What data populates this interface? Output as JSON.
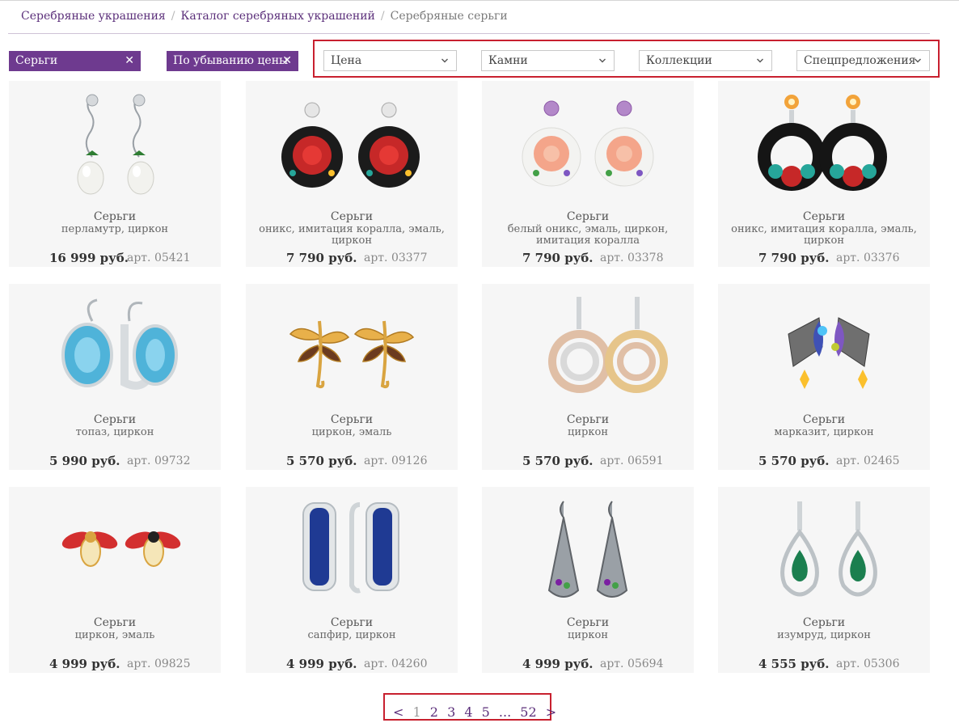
{
  "breadcrumb": {
    "items": [
      "Серебряные украшения",
      "Каталог серебряных украшений"
    ],
    "current": "Серебряные серьги"
  },
  "chips": [
    {
      "label": "Серьги"
    },
    {
      "label": "По убыванию цены"
    }
  ],
  "filters": [
    "Цена",
    "Камни",
    "Коллекции",
    "Спецпредложения"
  ],
  "products": [
    {
      "name": "Серьги",
      "materials": "перламутр, циркон",
      "price": "16 999 руб.",
      "article": "арт. 05421",
      "icon": "pearl-drop-earrings"
    },
    {
      "name": "Серьги",
      "materials": "оникс, имитация коралла, эмаль, циркон",
      "price": "7 790 руб.",
      "article": "арт. 03377",
      "icon": "red-rose-onyx-earrings"
    },
    {
      "name": "Серьги",
      "materials": "белый оникс, эмаль, циркон, имитация коралла",
      "price": "7 790 руб.",
      "article": "арт. 03378",
      "icon": "peach-rose-white-onyx-earrings"
    },
    {
      "name": "Серьги",
      "materials": "оникс, имитация коралла, эмаль, циркон",
      "price": "7 790 руб.",
      "article": "арт. 03376",
      "icon": "onyx-hoop-flower-earrings"
    },
    {
      "name": "Серьги",
      "materials": "топаз, циркон",
      "price": "5 990 руб.",
      "article": "арт. 09732",
      "icon": "blue-topaz-earrings"
    },
    {
      "name": "Серьги",
      "materials": "циркон, эмаль",
      "price": "5 570 руб.",
      "article": "арт. 09126",
      "icon": "dragonfly-earrings"
    },
    {
      "name": "Серьги",
      "materials": "циркон",
      "price": "5 570 руб.",
      "article": "арт. 06591",
      "icon": "swirl-earrings"
    },
    {
      "name": "Серьги",
      "materials": "марказит, циркон",
      "price": "5 570 руб.",
      "article": "арт. 02465",
      "icon": "butterfly-wing-earrings"
    },
    {
      "name": "Серьги",
      "materials": "циркон, эмаль",
      "price": "4 999 руб.",
      "article": "арт. 09825",
      "icon": "bee-stud-earrings"
    },
    {
      "name": "Серьги",
      "materials": "сапфир, циркон",
      "price": "4 999 руб.",
      "article": "арт. 04260",
      "icon": "sapphire-hoop-earrings"
    },
    {
      "name": "Серьги",
      "materials": "циркон",
      "price": "4 999 руб.",
      "article": "арт. 05694",
      "icon": "filigree-drop-earrings"
    },
    {
      "name": "Серьги",
      "materials": "изумруд, циркон",
      "price": "4 555 руб.",
      "article": "арт. 05306",
      "icon": "emerald-teardrop-earrings"
    }
  ],
  "pagination": {
    "prev": "<",
    "pages": [
      "1",
      "2",
      "3",
      "4",
      "5"
    ],
    "current": "1",
    "ellipsis": "...",
    "last": "52",
    "next": ">"
  },
  "colors": {
    "brand_purple": "#6e3a8f",
    "link_purple": "#5b2f7a",
    "highlight_red": "#c8202f",
    "card_bg": "#f6f6f6"
  }
}
